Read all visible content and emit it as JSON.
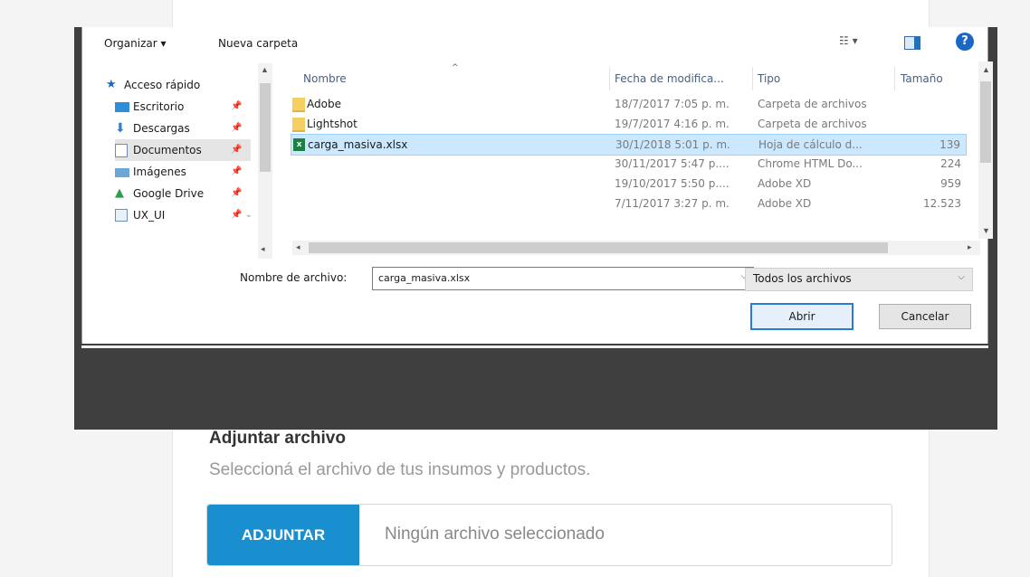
{
  "dialog": {
    "toolbar": {
      "organize_label": "Organizar ▾",
      "new_folder_label": "Nueva carpeta",
      "view_icon": "view-options-icon",
      "help_icon": "help-icon"
    },
    "nav": {
      "items": [
        {
          "label": "Acceso rápido",
          "icon": "star-icon"
        },
        {
          "label": "Escritorio",
          "icon": "desktop-icon"
        },
        {
          "label": "Descargas",
          "icon": "downloads-icon"
        },
        {
          "label": "Documentos",
          "icon": "documents-icon"
        },
        {
          "label": "Imágenes",
          "icon": "pictures-icon"
        },
        {
          "label": "Google Drive",
          "icon": "google-drive-icon"
        },
        {
          "label": "UX_UI",
          "icon": "folder-icon"
        }
      ],
      "selected": "Documentos"
    },
    "columns": {
      "name": "Nombre",
      "date": "Fecha de modifica...",
      "type": "Tipo",
      "size": "Tamaño"
    },
    "files": [
      {
        "name": "Adobe",
        "date": "18/7/2017 7:05 p. m.",
        "type": "Carpeta de archivos",
        "size": "",
        "kind": "folder"
      },
      {
        "name": "Lightshot",
        "date": "19/7/2017 4:16 p. m.",
        "type": "Carpeta de archivos",
        "size": "",
        "kind": "folder"
      },
      {
        "name": "carga_masiva.xlsx",
        "date": "30/1/2018 5:01 p. m.",
        "type": "Hoja de cálculo d...",
        "size": "139",
        "kind": "excel",
        "selected": true
      },
      {
        "name": "",
        "date": "30/11/2017 5:47 p....",
        "type": "Chrome HTML Do...",
        "size": "224",
        "kind": "none"
      },
      {
        "name": "",
        "date": "19/10/2017 5:50 p....",
        "type": "Adobe XD",
        "size": "959",
        "kind": "none"
      },
      {
        "name": "",
        "date": "7/11/2017 3:27 p. m.",
        "type": "Adobe XD",
        "size": "12.523",
        "kind": "none"
      }
    ],
    "filename_label": "Nombre de archivo:",
    "filename_value": "carga_masiva.xlsx",
    "filetype_value": "Todos los archivos",
    "open_label": "Abrir",
    "cancel_label": "Cancelar"
  },
  "page": {
    "attach_title": "Adjuntar archivo",
    "attach_subtitle": "Seleccioná el archivo de tus insumos y productos.",
    "attach_button": "ADJUNTAR",
    "attach_file_status": "Ningún archivo seleccionado",
    "accent_color": "#1a8fd0"
  }
}
